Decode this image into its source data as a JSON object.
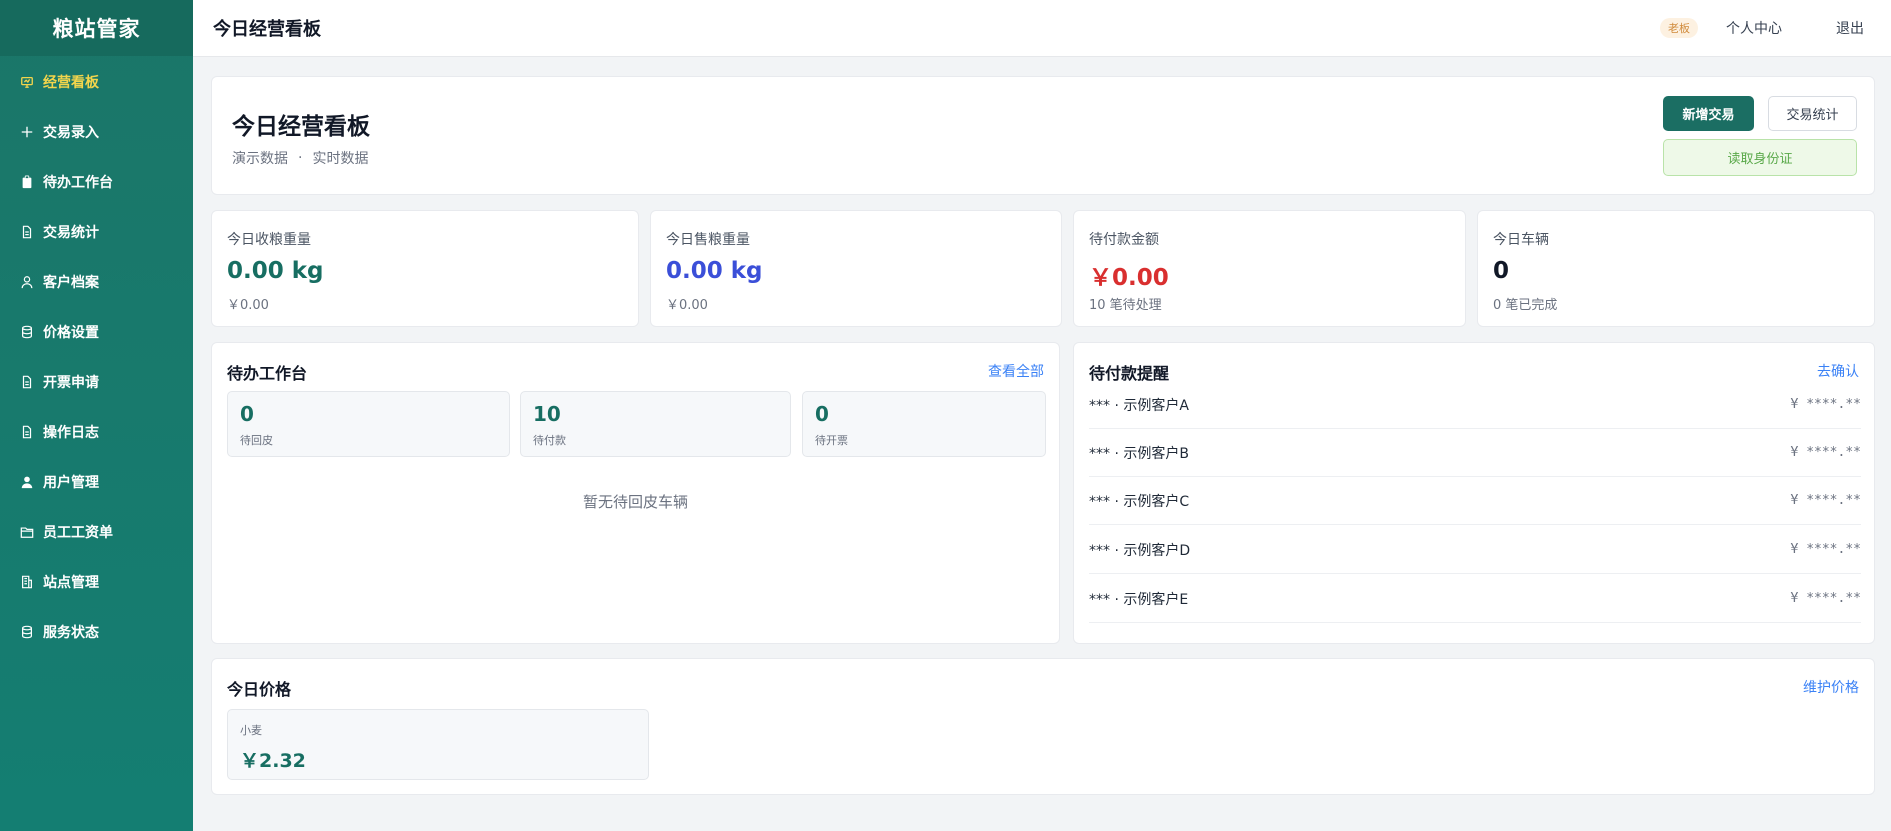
{
  "sidebar": {
    "brand": "粮站管家",
    "items": [
      {
        "label": "经营看板",
        "icon": "dashboard-icon"
      },
      {
        "label": "交易录入",
        "icon": "plus-icon"
      },
      {
        "label": "待办工作台",
        "icon": "clipboard-icon"
      },
      {
        "label": "交易统计",
        "icon": "document-icon"
      },
      {
        "label": "客户档案",
        "icon": "user-outline-icon"
      },
      {
        "label": "价格设置",
        "icon": "database-icon"
      },
      {
        "label": "开票申请",
        "icon": "document-icon"
      },
      {
        "label": "操作日志",
        "icon": "document-icon"
      },
      {
        "label": "用户管理",
        "icon": "user-filled-icon"
      },
      {
        "label": "员工工资单",
        "icon": "folder-icon"
      },
      {
        "label": "站点管理",
        "icon": "building-icon"
      },
      {
        "label": "服务状态",
        "icon": "database-icon"
      }
    ],
    "active_color": "#f3d54c"
  },
  "topbar": {
    "title": "今日经营看板",
    "role": "老板",
    "profile": "个人中心",
    "logout": "退出"
  },
  "hero": {
    "title": "今日经营看板",
    "sub1": "演示数据",
    "separator": "·",
    "sub2": "实时数据",
    "btn_new": "新增交易",
    "btn_stats": "交易统计",
    "btn_idcard": "读取身份证"
  },
  "stats": [
    {
      "label": "今日收粮重量",
      "value": "0.00 kg",
      "sub": "￥0.00"
    },
    {
      "label": "今日售粮重量",
      "value": "0.00 kg",
      "sub": "￥0.00"
    },
    {
      "label": "待付款金额",
      "value": "￥0.00",
      "sub": "10 笔待处理"
    },
    {
      "label": "今日车辆",
      "value": "0",
      "sub": "0 笔已完成"
    }
  ],
  "todo": {
    "title": "待办工作台",
    "link": "查看全部",
    "items": [
      {
        "value": "0",
        "label": "待回皮"
      },
      {
        "value": "10",
        "label": "待付款"
      },
      {
        "value": "0",
        "label": "待开票"
      }
    ],
    "empty": "暂无待回皮车辆"
  },
  "reminders": {
    "title": "待付款提醒",
    "link": "去确认",
    "rows": [
      {
        "name": "*** · 示例客户A",
        "amount": "¥ ****.**"
      },
      {
        "name": "*** · 示例客户B",
        "amount": "¥ ****.**"
      },
      {
        "name": "*** · 示例客户C",
        "amount": "¥ ****.**"
      },
      {
        "name": "*** · 示例客户D",
        "amount": "¥ ****.**"
      },
      {
        "name": "*** · 示例客户E",
        "amount": "¥ ****.**"
      }
    ]
  },
  "price": {
    "title": "今日价格",
    "link": "维护价格",
    "items": [
      {
        "name": "小麦",
        "value": "￥2.32"
      }
    ]
  }
}
